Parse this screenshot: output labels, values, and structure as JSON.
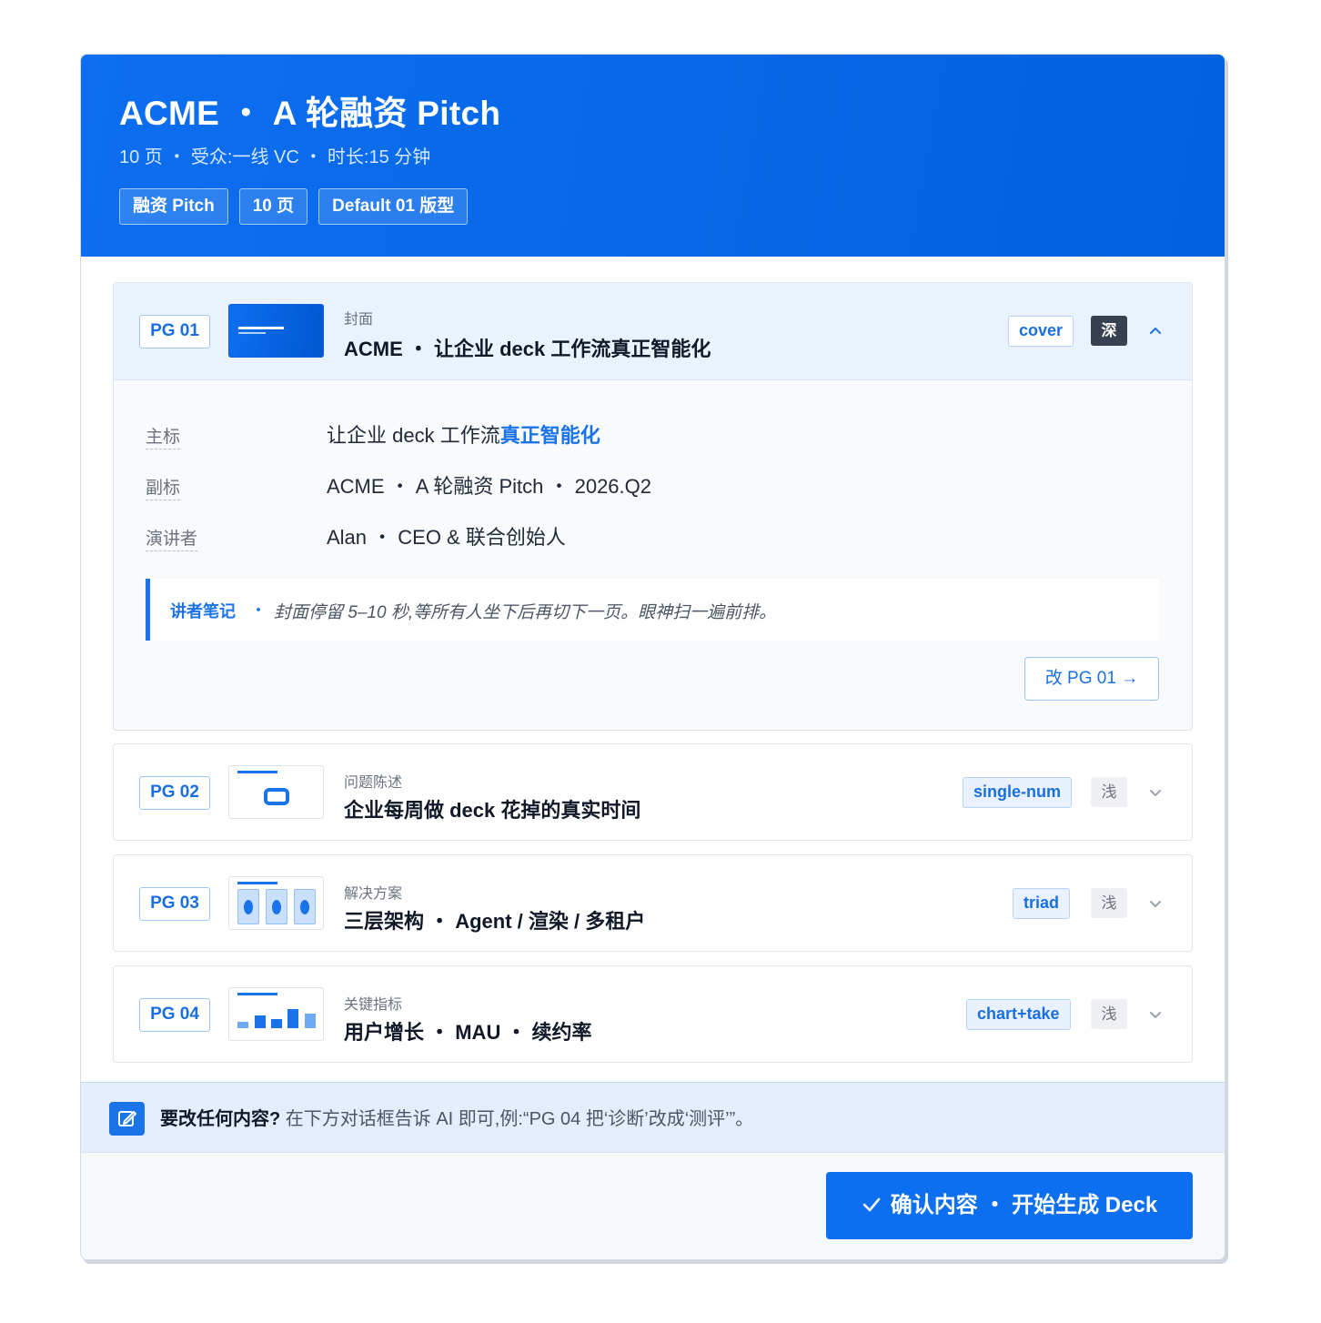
{
  "header": {
    "title": "ACME ・ A 轮融资 Pitch",
    "subtitle": "10 页 ・ 受众:一线 VC ・ 时长:15 分钟",
    "tags": [
      "融资 Pitch",
      "10 页",
      "Default 01 版型"
    ]
  },
  "pages": [
    {
      "badge": "PG 01",
      "kicker": "封面",
      "title": "ACME ・ 让企业 deck 工作流真正智能化",
      "layout": "cover",
      "tone": "深",
      "thumb_icon": "cover-thumbnail",
      "expanded": true,
      "fields": [
        {
          "label": "主标",
          "value": "让企业 deck 工作流",
          "highlight": "真正智能化"
        },
        {
          "label": "副标",
          "value": "ACME ・ A 轮融资 Pitch ・ 2026.Q2",
          "highlight": ""
        },
        {
          "label": "演讲者",
          "value": "Alan ・ CEO & 联合创始人",
          "highlight": ""
        }
      ],
      "note_label": "讲者笔记",
      "note_sep": "・",
      "note_text": "封面停留 5–10 秒,等所有人坐下后再切下一页。眼神扫一遍前排。",
      "edit_button": "改 PG 01 →"
    },
    {
      "badge": "PG 02",
      "kicker": "问题陈述",
      "title": "企业每周做 deck 花掉的真实时间",
      "layout": "single-num",
      "tone": "浅",
      "thumb_icon": "single-number-thumbnail",
      "expanded": false
    },
    {
      "badge": "PG 03",
      "kicker": "解决方案",
      "title": "三层架构 ・ Agent / 渲染 / 多租户",
      "layout": "triad",
      "tone": "浅",
      "thumb_icon": "triad-thumbnail",
      "expanded": false
    },
    {
      "badge": "PG 04",
      "kicker": "关键指标",
      "title": "用户增长 ・ MAU ・ 续约率",
      "layout": "chart+take",
      "tone": "浅",
      "thumb_icon": "chart-thumbnail",
      "expanded": false
    }
  ],
  "tip": {
    "icon": "edit-icon",
    "bold": "要改任何内容?",
    "text": "在下方对话框告诉 AI 即可,例:“PG 04 把‘诊断’改成‘测评’”。"
  },
  "confirm_button": "确认内容 ・ 开始生成 Deck",
  "colors": {
    "brand": "#0b6ff0",
    "accent_text": "#1a73e8",
    "dark_tone": "#374151"
  }
}
